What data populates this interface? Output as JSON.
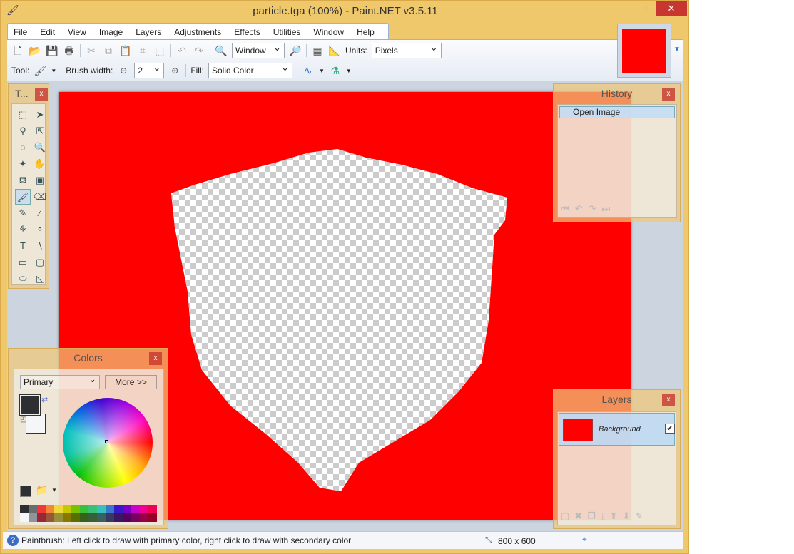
{
  "window": {
    "title": "particle.tga (100%) - Paint.NET v3.5.11",
    "minimize": "–",
    "maximize": "□",
    "close": "✕"
  },
  "menu": [
    "File",
    "Edit",
    "View",
    "Image",
    "Layers",
    "Adjustments",
    "Effects",
    "Utilities",
    "Window",
    "Help"
  ],
  "toolbar": {
    "zoom_value": "Window",
    "units_label": "Units:",
    "units_value": "Pixels",
    "tool_label": "Tool:",
    "brush_width_label": "Brush width:",
    "brush_width_value": "2",
    "fill_label": "Fill:",
    "fill_value": "Solid Color"
  },
  "tools_panel": {
    "title": "T...",
    "close": "x"
  },
  "history": {
    "title": "History",
    "close": "x",
    "items": [
      "Open Image"
    ]
  },
  "colors": {
    "title": "Colors",
    "close": "x",
    "mode": "Primary",
    "more_button": "More >>",
    "primary_color": "#2d2f33",
    "secondary_color": "#f4f6f8",
    "palette": [
      "#2d2f33",
      "#6a6c70",
      "#f03838",
      "#f08838",
      "#f0d838",
      "#c8c800",
      "#78c000",
      "#38c038",
      "#38c078",
      "#38c0c0",
      "#3878c8",
      "#3818c8",
      "#7800c8",
      "#c800c8",
      "#f00090",
      "#f00050",
      "#f4f6f8",
      "#909498",
      "#982838",
      "#985838",
      "#989038",
      "#887800",
      "#587000",
      "#386018",
      "#386038",
      "#386060",
      "#383860",
      "#381860",
      "#580060",
      "#780060",
      "#980048",
      "#980028"
    ]
  },
  "layers": {
    "title": "Layers",
    "close": "x",
    "items": [
      {
        "name": "Background",
        "visible": true
      }
    ]
  },
  "canvas": {
    "background_color": "#ff0000"
  },
  "status": {
    "hint": "Paintbrush: Left click to draw with primary color, right click to draw with secondary color",
    "image_size": "800 x 600"
  }
}
